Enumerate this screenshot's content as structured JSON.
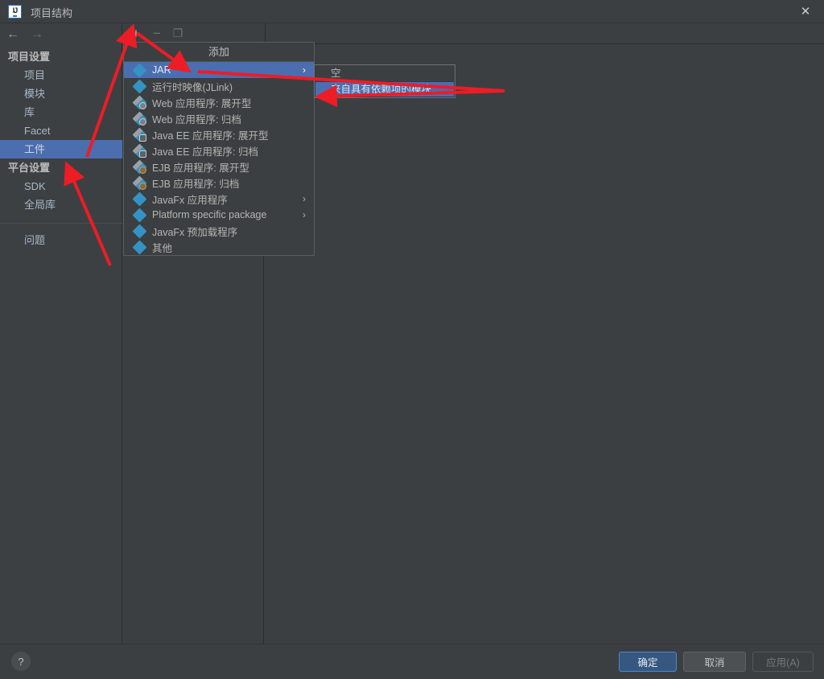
{
  "window": {
    "title": "项目结构",
    "logo_text": "IJ",
    "close_icon": "close-icon"
  },
  "nav": {
    "back_icon": "←",
    "forward_icon": "→"
  },
  "sidebar": {
    "groups": [
      {
        "label": "项目设置",
        "items": [
          {
            "label": "项目",
            "selected": false
          },
          {
            "label": "模块",
            "selected": false
          },
          {
            "label": "库",
            "selected": false
          },
          {
            "label": "Facet",
            "selected": false
          },
          {
            "label": "工件",
            "selected": true
          }
        ]
      },
      {
        "label": "平台设置",
        "items": [
          {
            "label": "SDK",
            "selected": false
          },
          {
            "label": "全局库",
            "selected": false
          }
        ]
      }
    ],
    "footer_items": [
      {
        "label": "问题",
        "selected": false
      }
    ]
  },
  "toolbar": {
    "add_label": "+",
    "remove_label": "−",
    "copy_label": "❐"
  },
  "popup": {
    "title": "添加",
    "items": [
      {
        "label": "JAR",
        "icon": "artifact-icon",
        "badge": "",
        "selected": true,
        "has_submenu": true
      },
      {
        "label": "运行时映像(JLink)",
        "icon": "artifact-icon",
        "badge": "",
        "selected": false,
        "has_submenu": false
      },
      {
        "label": "Web 应用程序: 展开型",
        "icon": "artifact-web-icon",
        "badge": "globe",
        "selected": false,
        "has_submenu": false
      },
      {
        "label": "Web 应用程序: 归档",
        "icon": "artifact-web-icon",
        "badge": "globe",
        "selected": false,
        "has_submenu": false
      },
      {
        "label": "Java EE 应用程序: 展开型",
        "icon": "artifact-javaee-icon",
        "badge": "grid",
        "selected": false,
        "has_submenu": false
      },
      {
        "label": "Java EE 应用程序: 归档",
        "icon": "artifact-javaee-icon",
        "badge": "grid",
        "selected": false,
        "has_submenu": false
      },
      {
        "label": "EJB 应用程序: 展开型",
        "icon": "artifact-ejb-icon",
        "badge": "bean",
        "selected": false,
        "has_submenu": false
      },
      {
        "label": "EJB 应用程序: 归档",
        "icon": "artifact-ejb-icon",
        "badge": "bean",
        "selected": false,
        "has_submenu": false
      },
      {
        "label": "JavaFx 应用程序",
        "icon": "artifact-icon",
        "badge": "",
        "selected": false,
        "has_submenu": true
      },
      {
        "label": "Platform specific package",
        "icon": "artifact-icon",
        "badge": "",
        "selected": false,
        "has_submenu": true
      },
      {
        "label": "JavaFx 预加载程序",
        "icon": "artifact-icon",
        "badge": "",
        "selected": false,
        "has_submenu": false
      },
      {
        "label": "其他",
        "icon": "artifact-icon",
        "badge": "",
        "selected": false,
        "has_submenu": false
      }
    ],
    "submenu_arrow": "›"
  },
  "submenu": {
    "items": [
      {
        "label": "空",
        "selected": false
      },
      {
        "label": "来自具有依赖项的模块...",
        "selected": true
      }
    ]
  },
  "bottom": {
    "help_label": "?",
    "ok_label": "确定",
    "cancel_label": "取消",
    "apply_label": "应用(A)"
  },
  "colors": {
    "accent_blue": "#4b6eaf",
    "primary_button": "#365880",
    "annotation_red": "#ee1c25",
    "background": "#3c3f41",
    "sidebar_background": "#3c4043",
    "icon_blue": "#3592c4"
  }
}
